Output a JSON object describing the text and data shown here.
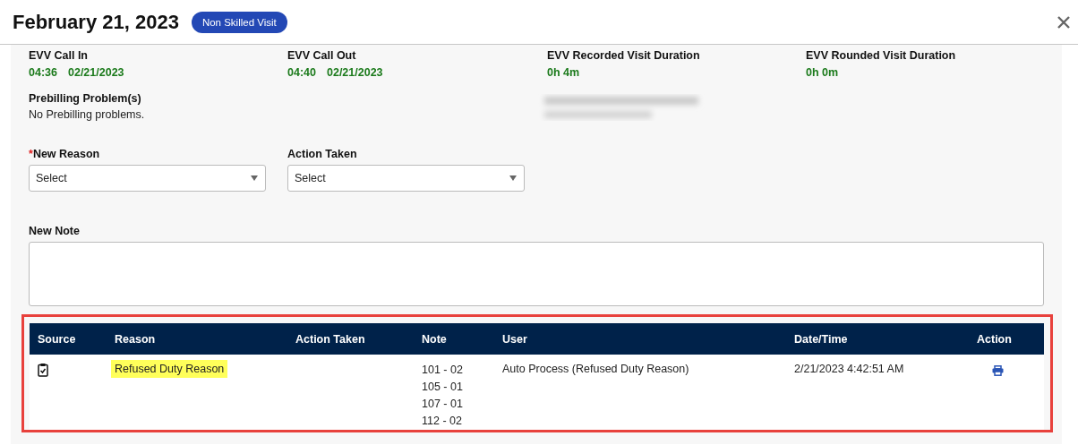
{
  "header": {
    "title": "February 21, 2023",
    "badge": "Non Skilled Visit"
  },
  "info": [
    {
      "label": "EVV Call In",
      "values": [
        "04:36",
        "02/21/2023"
      ]
    },
    {
      "label": "EVV Call Out",
      "values": [
        "04:40",
        "02/21/2023"
      ]
    },
    {
      "label": "EVV Recorded Visit Duration",
      "values": [
        "0h 4m"
      ]
    },
    {
      "label": "EVV Rounded Visit Duration",
      "values": [
        "0h 0m"
      ]
    }
  ],
  "prebilling": {
    "label": "Prebilling Problem(s)",
    "text": "No Prebilling problems."
  },
  "form": {
    "selects": [
      {
        "label": "New Reason",
        "required_mark": "*",
        "value": "Select"
      },
      {
        "label": "Action Taken",
        "value": "Select"
      }
    ],
    "note_label": "New Note"
  },
  "table": {
    "outlined": true,
    "columns": [
      "Source",
      "Reason",
      "Action Taken",
      "Note",
      "User",
      "Date/Time",
      "Action"
    ],
    "rows": [
      {
        "reason": "Refused Duty Reason",
        "highlighted": true,
        "notes": [
          "101 - 02",
          "105 - 01",
          "107 - 01",
          "112 - 02"
        ],
        "user": "Auto Process (Refused Duty Reason)",
        "datetime": "2/21/2023 4:42:51 AM"
      }
    ]
  }
}
